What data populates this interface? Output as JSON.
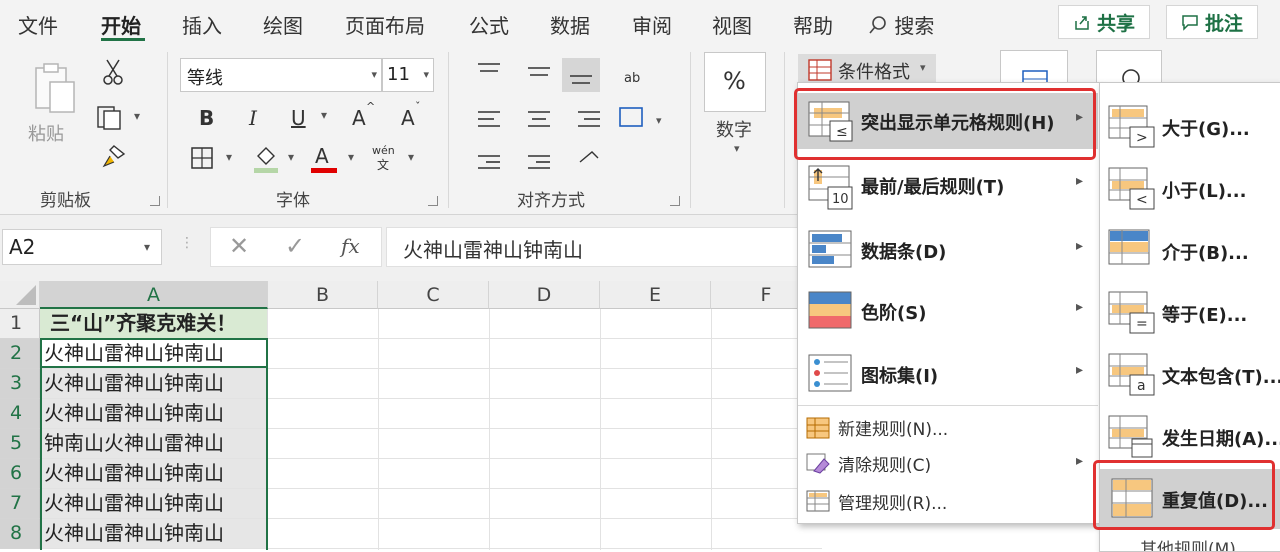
{
  "menubar": {
    "tabs": [
      "文件",
      "开始",
      "插入",
      "绘图",
      "页面布局",
      "公式",
      "数据",
      "审阅",
      "视图",
      "帮助"
    ],
    "search": "搜索",
    "share": "共享",
    "comments": "批注"
  },
  "ribbon": {
    "clipboard": {
      "paste": "粘贴",
      "label": "剪贴板"
    },
    "font": {
      "name": "等线",
      "size": "11",
      "bold": "B",
      "italic": "I",
      "underline": "U",
      "grow": "A",
      "shrink": "A",
      "color_a": "A",
      "phonetic": "wén",
      "phonetic_char": "文",
      "label": "字体"
    },
    "alignment": {
      "label": "对齐方式",
      "wrap_text": "ab"
    },
    "number": {
      "percent": "%",
      "label": "数字"
    },
    "cond_format": "条件格式"
  },
  "formula_bar": {
    "name_box": "A2",
    "fx": "fx",
    "value": "火神山雷神山钟南山"
  },
  "grid": {
    "columns": [
      "A",
      "B",
      "C",
      "D",
      "E",
      "F"
    ],
    "rows": [
      "1",
      "2",
      "3",
      "4",
      "5",
      "6",
      "7",
      "8"
    ],
    "a_values": [
      "三“山”齐聚克难关！",
      "火神山雷神山钟南山",
      "火神山雷神山钟南山",
      "火神山雷神山钟南山",
      "钟南山火神山雷神山",
      "火神山雷神山钟南山",
      "火神山雷神山钟南山",
      "火神山雷神山钟南山"
    ]
  },
  "menu1": {
    "items": [
      {
        "label": "突出显示单元格规则(H)",
        "icon": "highlight-cells-icon"
      },
      {
        "label": "最前/最后规则(T)",
        "icon": "top-bottom-icon"
      },
      {
        "label": "数据条(D)",
        "icon": "data-bars-icon"
      },
      {
        "label": "色阶(S)",
        "icon": "color-scales-icon"
      },
      {
        "label": "图标集(I)",
        "icon": "icon-sets-icon"
      }
    ],
    "small_items": [
      "新建规则(N)...",
      "清除规则(C)",
      "管理规则(R)..."
    ]
  },
  "menu2": {
    "items": [
      "大于(G)...",
      "小于(L)...",
      "介于(B)...",
      "等于(E)...",
      "文本包含(T)...",
      "发生日期(A)...",
      "重复值(D)..."
    ],
    "more": "其他规则(M)..."
  },
  "colors": {
    "accent": "#217346",
    "highlight_box": "#e03030",
    "menu_hover": "#d0d0d0",
    "header_fill": "#d9ead3"
  }
}
